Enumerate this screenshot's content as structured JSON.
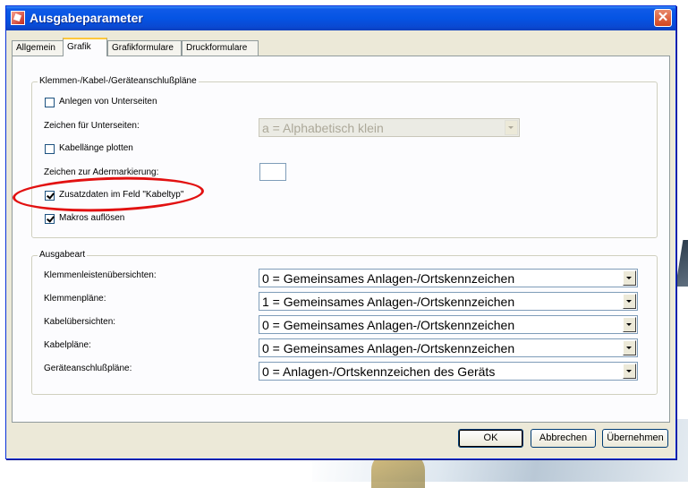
{
  "window": {
    "title": "Ausgabeparameter",
    "close_glyph": "✕"
  },
  "tabs": [
    {
      "label": "Allgemein",
      "active": false
    },
    {
      "label": "Grafik",
      "active": true
    },
    {
      "label": "Grafikformulare",
      "active": false
    },
    {
      "label": "Druckformulare",
      "active": false
    }
  ],
  "group1": {
    "legend": "Klemmen-/Kabel-/Geräteanschlußpläne",
    "anlegen_unterseiten": {
      "label": "Anlegen von Unterseiten",
      "checked": false
    },
    "zeichen_unterseiten": {
      "label": "Zeichen für Unterseiten:",
      "value": "a = Alphabetisch klein",
      "enabled": false
    },
    "kabellaenge": {
      "label": "Kabellänge plotten",
      "checked": false
    },
    "adermarkierung": {
      "label": "Zeichen zur Adermarkierung:",
      "value": ""
    },
    "zusatzdaten": {
      "label": "Zusatzdaten im Feld \"Kabeltyp\"",
      "checked": true
    },
    "makros": {
      "label": "Makros auflösen",
      "checked": true
    }
  },
  "group2": {
    "legend": "Ausgabeart",
    "rows": [
      {
        "label": "Klemmenleistenübersichten:",
        "value": "0 = Gemeinsames Anlagen-/Ortskennzeichen"
      },
      {
        "label": "Klemmenpläne:",
        "value": "1 = Gemeinsames Anlagen-/Ortskennzeichen"
      },
      {
        "label": "Kabelübersichten:",
        "value": "0 = Gemeinsames Anlagen-/Ortskennzeichen"
      },
      {
        "label": "Kabelpläne:",
        "value": "0 = Gemeinsames Anlagen-/Ortskennzeichen"
      },
      {
        "label": "Geräteanschlußpläne:",
        "value": "0 = Anlagen-/Ortskennzeichen des Geräts"
      }
    ]
  },
  "buttons": {
    "ok": "OK",
    "cancel": "Abbrechen",
    "apply": "Übernehmen"
  },
  "colors": {
    "annotation": "#e21111",
    "titlebar": "#0554e3"
  }
}
